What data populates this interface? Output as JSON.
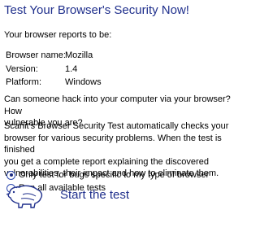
{
  "title": "Test Your Browser's Security Now!",
  "intro": "Your browser reports to be:",
  "browser_info": [
    {
      "label": "Browser name:",
      "value": "Mozilla"
    },
    {
      "label": "Version:",
      "value": "1.4"
    },
    {
      "label": "Platform:",
      "value": "Windows"
    }
  ],
  "question": {
    "line1": "Can someone hack into your computer via your browser? How",
    "line2": "vulnerable you are?"
  },
  "description": {
    "line1": "Scanit's Browser Security Test automatically checks your",
    "line2": "browser for various security problems. When the test is finished",
    "line3": "you get a complete report explaining the discovered",
    "line4": "vulnerabilities, their impact and how to eliminate them."
  },
  "options": [
    {
      "label": "Only test for bugs specific to my type of browser",
      "selected": true
    },
    {
      "label": "Run all available tests",
      "selected": false
    }
  ],
  "start_link": "Start the test",
  "colors": {
    "accent": "#1f2f8c",
    "radio_border": "#2f4bb0"
  },
  "icons": {
    "mascot": "bear-mascot-icon"
  }
}
